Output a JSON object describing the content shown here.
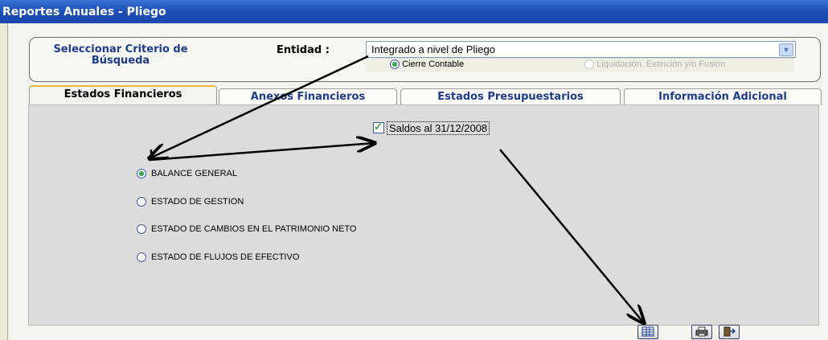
{
  "window": {
    "title": "Reportes Anuales - Pliego"
  },
  "criteria": {
    "label": "Seleccionar Criterio de Búsqueda",
    "entity_label": "Entidad :",
    "entity_value": "Integrado a nivel de Pliego",
    "options": [
      "Cierre Contable",
      "Liquidación, Extinción y/o Fusión"
    ],
    "selected_option": "Cierre Contable"
  },
  "tabs": [
    "Estados Financieros",
    "Anexos Financieros",
    "Estados Presupuestarios",
    "Información Adicional"
  ],
  "active_tab": "Estados Financieros",
  "panel": {
    "checkbox_label": "Saldos al 31/12/2008",
    "checkbox_checked": true,
    "reports": [
      "BALANCE GENERAL",
      "ESTADO DE GESTION",
      "ESTADO DE CAMBIOS EN EL PATRIMONIO NETO",
      "ESTADO DE FLUJOS DE EFECTIVO"
    ],
    "selected_report": "BALANCE GENERAL"
  },
  "toolbar": {
    "icons": [
      "report-icon",
      "print-icon",
      "exit-icon"
    ]
  }
}
